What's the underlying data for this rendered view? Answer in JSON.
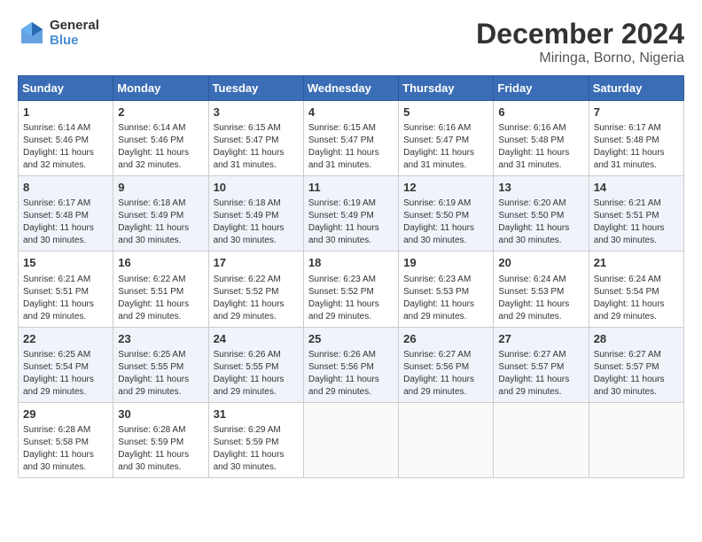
{
  "header": {
    "logo_line1": "General",
    "logo_line2": "Blue",
    "title": "December 2024",
    "subtitle": "Miringa, Borno, Nigeria"
  },
  "calendar": {
    "days_of_week": [
      "Sunday",
      "Monday",
      "Tuesday",
      "Wednesday",
      "Thursday",
      "Friday",
      "Saturday"
    ],
    "weeks": [
      [
        {
          "day": "",
          "info": ""
        },
        {
          "day": "2",
          "info": "Sunrise: 6:14 AM\nSunset: 5:46 PM\nDaylight: 11 hours\nand 32 minutes."
        },
        {
          "day": "3",
          "info": "Sunrise: 6:15 AM\nSunset: 5:47 PM\nDaylight: 11 hours\nand 31 minutes."
        },
        {
          "day": "4",
          "info": "Sunrise: 6:15 AM\nSunset: 5:47 PM\nDaylight: 11 hours\nand 31 minutes."
        },
        {
          "day": "5",
          "info": "Sunrise: 6:16 AM\nSunset: 5:47 PM\nDaylight: 11 hours\nand 31 minutes."
        },
        {
          "day": "6",
          "info": "Sunrise: 6:16 AM\nSunset: 5:48 PM\nDaylight: 11 hours\nand 31 minutes."
        },
        {
          "day": "7",
          "info": "Sunrise: 6:17 AM\nSunset: 5:48 PM\nDaylight: 11 hours\nand 31 minutes."
        }
      ],
      [
        {
          "day": "1",
          "info": "Sunrise: 6:14 AM\nSunset: 5:46 PM\nDaylight: 11 hours\nand 32 minutes."
        },
        {
          "day": "9",
          "info": "Sunrise: 6:18 AM\nSunset: 5:49 PM\nDaylight: 11 hours\nand 30 minutes."
        },
        {
          "day": "10",
          "info": "Sunrise: 6:18 AM\nSunset: 5:49 PM\nDaylight: 11 hours\nand 30 minutes."
        },
        {
          "day": "11",
          "info": "Sunrise: 6:19 AM\nSunset: 5:49 PM\nDaylight: 11 hours\nand 30 minutes."
        },
        {
          "day": "12",
          "info": "Sunrise: 6:19 AM\nSunset: 5:50 PM\nDaylight: 11 hours\nand 30 minutes."
        },
        {
          "day": "13",
          "info": "Sunrise: 6:20 AM\nSunset: 5:50 PM\nDaylight: 11 hours\nand 30 minutes."
        },
        {
          "day": "14",
          "info": "Sunrise: 6:21 AM\nSunset: 5:51 PM\nDaylight: 11 hours\nand 30 minutes."
        }
      ],
      [
        {
          "day": "8",
          "info": "Sunrise: 6:17 AM\nSunset: 5:48 PM\nDaylight: 11 hours\nand 30 minutes."
        },
        {
          "day": "16",
          "info": "Sunrise: 6:22 AM\nSunset: 5:51 PM\nDaylight: 11 hours\nand 29 minutes."
        },
        {
          "day": "17",
          "info": "Sunrise: 6:22 AM\nSunset: 5:52 PM\nDaylight: 11 hours\nand 29 minutes."
        },
        {
          "day": "18",
          "info": "Sunrise: 6:23 AM\nSunset: 5:52 PM\nDaylight: 11 hours\nand 29 minutes."
        },
        {
          "day": "19",
          "info": "Sunrise: 6:23 AM\nSunset: 5:53 PM\nDaylight: 11 hours\nand 29 minutes."
        },
        {
          "day": "20",
          "info": "Sunrise: 6:24 AM\nSunset: 5:53 PM\nDaylight: 11 hours\nand 29 minutes."
        },
        {
          "day": "21",
          "info": "Sunrise: 6:24 AM\nSunset: 5:54 PM\nDaylight: 11 hours\nand 29 minutes."
        }
      ],
      [
        {
          "day": "15",
          "info": "Sunrise: 6:21 AM\nSunset: 5:51 PM\nDaylight: 11 hours\nand 29 minutes."
        },
        {
          "day": "23",
          "info": "Sunrise: 6:25 AM\nSunset: 5:55 PM\nDaylight: 11 hours\nand 29 minutes."
        },
        {
          "day": "24",
          "info": "Sunrise: 6:26 AM\nSunset: 5:55 PM\nDaylight: 11 hours\nand 29 minutes."
        },
        {
          "day": "25",
          "info": "Sunrise: 6:26 AM\nSunset: 5:56 PM\nDaylight: 11 hours\nand 29 minutes."
        },
        {
          "day": "26",
          "info": "Sunrise: 6:27 AM\nSunset: 5:56 PM\nDaylight: 11 hours\nand 29 minutes."
        },
        {
          "day": "27",
          "info": "Sunrise: 6:27 AM\nSunset: 5:57 PM\nDaylight: 11 hours\nand 29 minutes."
        },
        {
          "day": "28",
          "info": "Sunrise: 6:27 AM\nSunset: 5:57 PM\nDaylight: 11 hours\nand 30 minutes."
        }
      ],
      [
        {
          "day": "22",
          "info": "Sunrise: 6:25 AM\nSunset: 5:54 PM\nDaylight: 11 hours\nand 29 minutes."
        },
        {
          "day": "30",
          "info": "Sunrise: 6:28 AM\nSunset: 5:59 PM\nDaylight: 11 hours\nand 30 minutes."
        },
        {
          "day": "31",
          "info": "Sunrise: 6:29 AM\nSunset: 5:59 PM\nDaylight: 11 hours\nand 30 minutes."
        },
        {
          "day": "",
          "info": ""
        },
        {
          "day": "",
          "info": ""
        },
        {
          "day": "",
          "info": ""
        },
        {
          "day": "",
          "info": ""
        }
      ],
      [
        {
          "day": "29",
          "info": "Sunrise: 6:28 AM\nSunset: 5:58 PM\nDaylight: 11 hours\nand 30 minutes."
        },
        {
          "day": "",
          "info": ""
        },
        {
          "day": "",
          "info": ""
        },
        {
          "day": "",
          "info": ""
        },
        {
          "day": "",
          "info": ""
        },
        {
          "day": "",
          "info": ""
        },
        {
          "day": "",
          "info": ""
        }
      ]
    ]
  }
}
